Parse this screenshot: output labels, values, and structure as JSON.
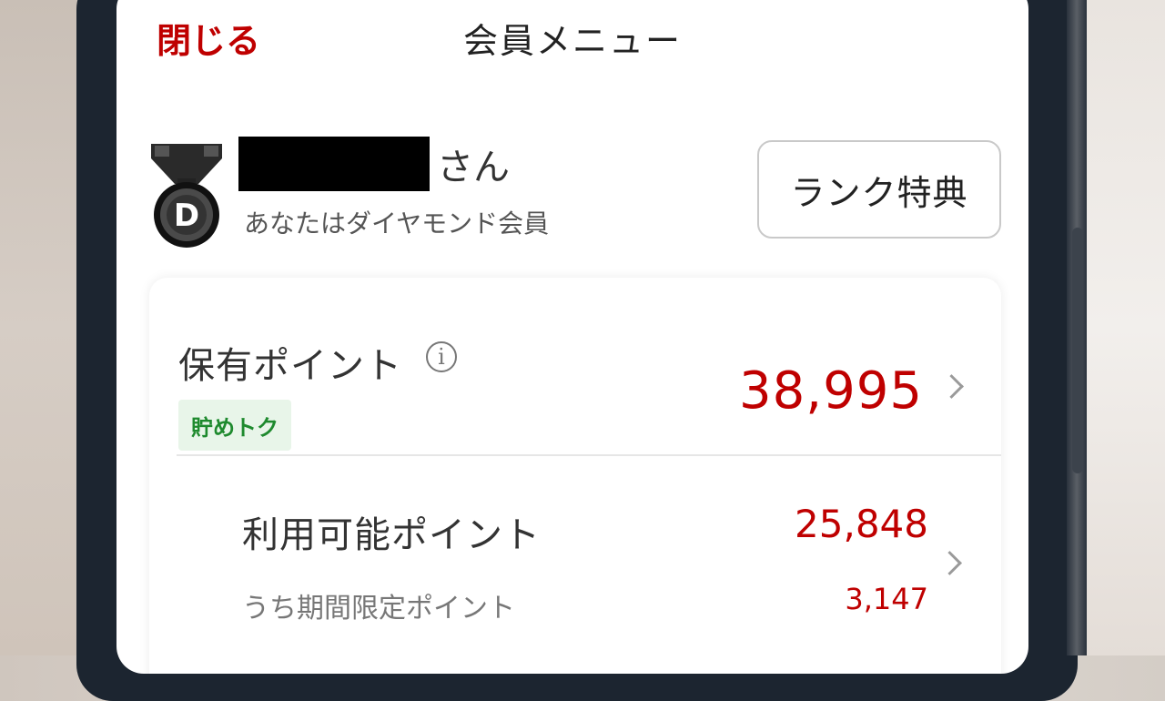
{
  "header": {
    "close_label": "閉じる",
    "title": "会員メニュー"
  },
  "member": {
    "name_suffix": "さん",
    "rank_text": "あなたはダイヤモンド会員",
    "medal_letter": "D",
    "rank_benefit_button": "ランク特典"
  },
  "points": {
    "held_label": "保有ポイント",
    "info_icon": "i",
    "badge": "貯めトク",
    "held_value": "38,995",
    "available_label": "利用可能ポイント",
    "available_value": "25,848",
    "limited_label": "うち期間限定ポイント",
    "limited_value": "3,147"
  },
  "colors": {
    "accent": "#bf0000",
    "badge_green": "#1e8a2e"
  }
}
